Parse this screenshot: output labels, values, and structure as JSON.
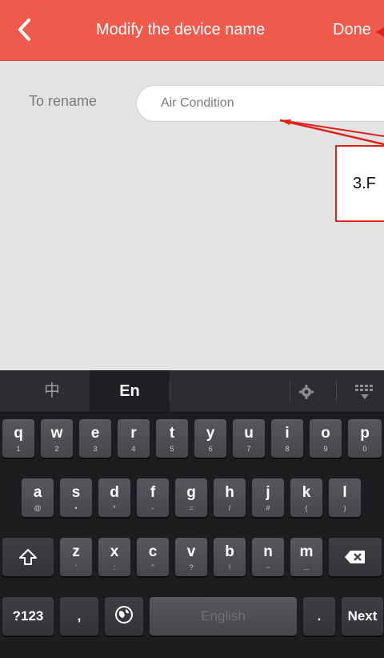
{
  "header": {
    "title": "Modify the device name",
    "done_label": "Done"
  },
  "form": {
    "label": "To rename",
    "input_value": "Air Condition"
  },
  "annotation": {
    "text": "3.F",
    "color": "#e0201a"
  },
  "keyboard": {
    "tabs": [
      {
        "label": "中"
      },
      {
        "label": "En"
      }
    ],
    "row1": [
      {
        "main": "q",
        "sub": "1"
      },
      {
        "main": "w",
        "sub": "2"
      },
      {
        "main": "e",
        "sub": "3"
      },
      {
        "main": "r",
        "sub": "4"
      },
      {
        "main": "t",
        "sub": "5"
      },
      {
        "main": "y",
        "sub": "6"
      },
      {
        "main": "u",
        "sub": "7"
      },
      {
        "main": "i",
        "sub": "8"
      },
      {
        "main": "o",
        "sub": "9"
      },
      {
        "main": "p",
        "sub": "0"
      }
    ],
    "row2": [
      {
        "main": "a",
        "sub": "@"
      },
      {
        "main": "s",
        "sub": "•"
      },
      {
        "main": "d",
        "sub": "*"
      },
      {
        "main": "f",
        "sub": "-"
      },
      {
        "main": "g",
        "sub": "="
      },
      {
        "main": "h",
        "sub": "/"
      },
      {
        "main": "j",
        "sub": "#"
      },
      {
        "main": "k",
        "sub": "("
      },
      {
        "main": "l",
        "sub": ")"
      }
    ],
    "row3": [
      {
        "main": "z",
        "sub": "'"
      },
      {
        "main": "x",
        "sub": ":"
      },
      {
        "main": "c",
        "sub": "\""
      },
      {
        "main": "v",
        "sub": "?"
      },
      {
        "main": "b",
        "sub": "!"
      },
      {
        "main": "n",
        "sub": "~"
      },
      {
        "main": "m",
        "sub": "..."
      }
    ],
    "symbols_label": "?123",
    "comma_label": ",",
    "space_label": "English",
    "period_label": ".",
    "next_label": "Next"
  },
  "colors": {
    "header_bg": "#ef5a4d",
    "page_bg": "#e3e3e3",
    "keyboard_bg": "#1c1d1f"
  }
}
